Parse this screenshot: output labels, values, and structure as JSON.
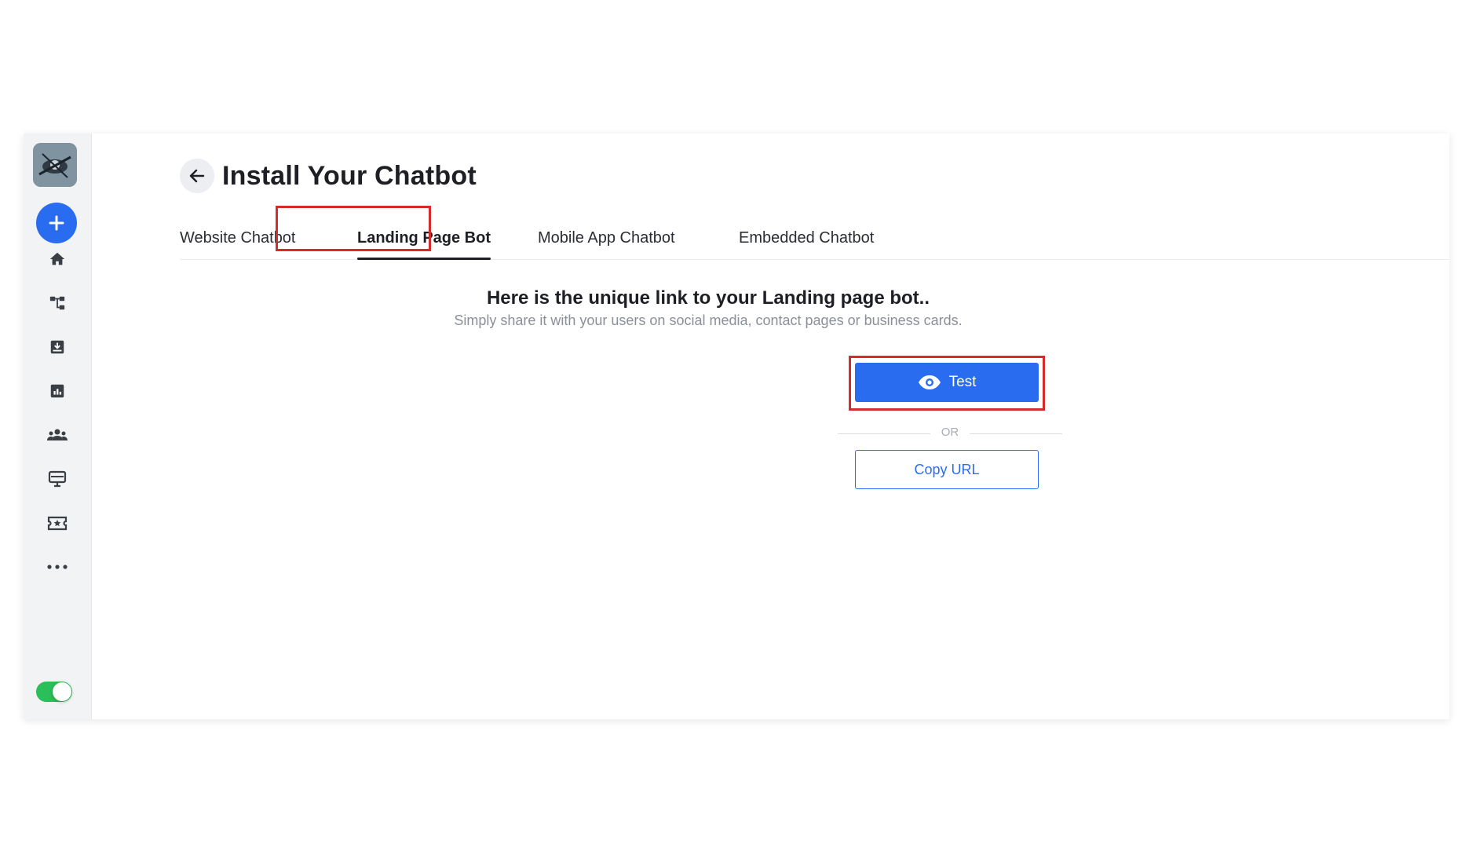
{
  "page": {
    "title": "Install Your Chatbot"
  },
  "sidebar": {
    "logo": "bot-avatar-logo",
    "add_icon": "plus-icon",
    "items": [
      {
        "icon": "home-icon"
      },
      {
        "icon": "flow-icon"
      },
      {
        "icon": "inbox-icon"
      },
      {
        "icon": "analytics-icon"
      },
      {
        "icon": "users-icon"
      },
      {
        "icon": "monitor-icon"
      },
      {
        "icon": "ticket-icon"
      },
      {
        "icon": "more-icon"
      }
    ],
    "toggle_on": true
  },
  "tabs": [
    {
      "label": "Website Chatbot",
      "active": false
    },
    {
      "label": "Landing Page Bot",
      "active": true
    },
    {
      "label": "Mobile App Chatbot",
      "active": false
    },
    {
      "label": "Embedded Chatbot",
      "active": false
    }
  ],
  "content": {
    "heading": "Here is the unique link to your Landing page bot..",
    "subheading": "Simply share it with your users on social media, contact pages or business cards.",
    "test_label": "Test",
    "or_label": "OR",
    "copy_label": "Copy URL"
  },
  "colors": {
    "accent": "#2a6cf0",
    "highlight": "#d52b2b",
    "toggle": "#2bbf5a"
  }
}
